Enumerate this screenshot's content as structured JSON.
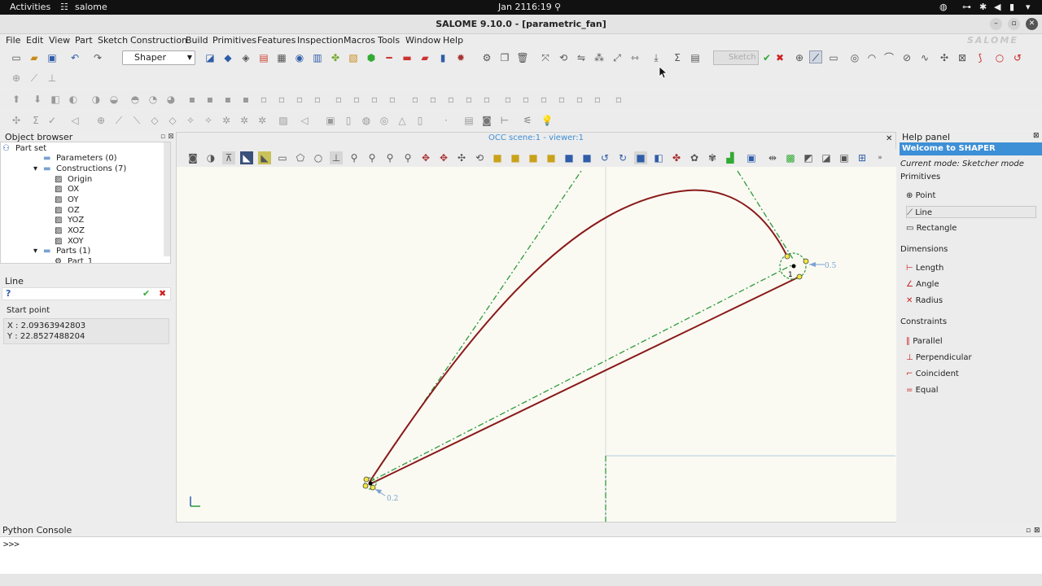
{
  "gnome": {
    "activities": "Activities",
    "app": "salome",
    "date": "Jan 21",
    "time": "16:19"
  },
  "window": {
    "title": "SALOME 9.10.0 - [parametric_fan]",
    "minimize": "–",
    "maximize": "▫",
    "close": "✕",
    "watermark": "SALOME"
  },
  "menu": [
    "File",
    "Edit",
    "View",
    "Part",
    "Sketch",
    "Construction",
    "Build",
    "Primitives",
    "Features",
    "Inspection",
    "Macros",
    "Tools",
    "Window",
    "Help"
  ],
  "toolbar": {
    "module": "Shaper",
    "sketch_label": "Sketch"
  },
  "object_browser": {
    "title": "Object browser",
    "root": "Part set",
    "items": [
      {
        "label": "Parameters (0)"
      },
      {
        "label": "Constructions (7)"
      },
      {
        "label": "Origin"
      },
      {
        "label": "OX"
      },
      {
        "label": "OY"
      },
      {
        "label": "OZ"
      },
      {
        "label": "YOZ"
      },
      {
        "label": "XOZ"
      },
      {
        "label": "XOY"
      },
      {
        "label": "Parts (1)"
      },
      {
        "label": "Part_1"
      }
    ]
  },
  "line_panel": {
    "title": "Line",
    "help_icon": "?",
    "ok": "✔",
    "cancel": "✖",
    "start_point": "Start point",
    "x": "X : 2.09363942803",
    "y": "Y : 22.8527488204"
  },
  "viewer": {
    "title": "OCC scene:1 - viewer:1",
    "label_start": "0.2",
    "label_end": "0.5",
    "marker": "1"
  },
  "help_panel": {
    "title": "Help panel",
    "welcome": "Welcome to SHAPER",
    "mode": "Current mode: Sketcher mode",
    "primitives_header": "Primitives",
    "primitives": [
      "Point",
      "Line",
      "Rectangle"
    ],
    "dimensions_header": "Dimensions",
    "dimensions": [
      "Length",
      "Angle",
      "Radius"
    ],
    "constraints_header": "Constraints",
    "constraints": [
      "Parallel",
      "Perpendicular",
      "Coincident",
      "Equal"
    ]
  },
  "console": {
    "title": "Python Console",
    "prompt": ">>>"
  },
  "colors": {
    "accent": "#3d8fd6",
    "curve": "#8b1a1a",
    "construction": "#2e9a3a"
  }
}
